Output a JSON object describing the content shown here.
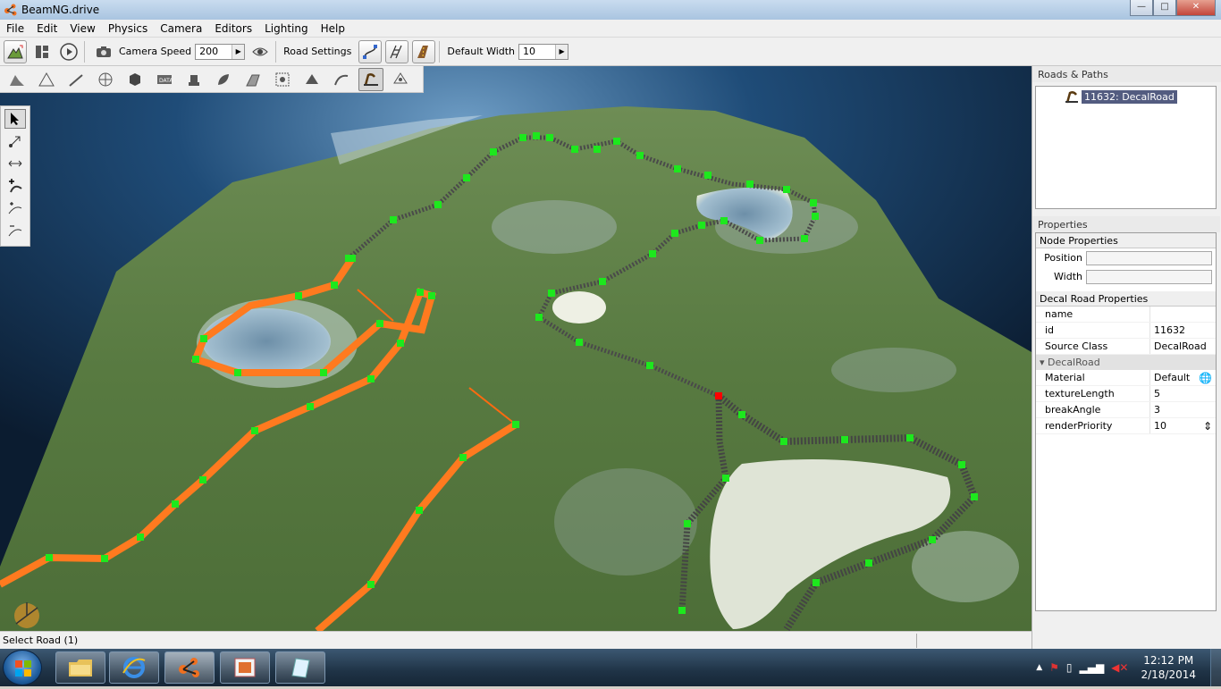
{
  "window": {
    "title": "BeamNG.drive",
    "minimize": "—",
    "maximize": "□",
    "close": "✕"
  },
  "menu": [
    "File",
    "Edit",
    "View",
    "Physics",
    "Camera",
    "Editors",
    "Lighting",
    "Help"
  ],
  "toolbar": {
    "camera_speed_label": "Camera Speed",
    "camera_speed_value": "200",
    "road_settings_label": "Road Settings",
    "default_width_label": "Default Width",
    "default_width_value": "10"
  },
  "editor_tools": [
    "terrain-editor-icon",
    "terrain-painter-icon",
    "mesh-road-icon",
    "river-icon",
    "object-icon",
    "datablock-icon",
    "forest-icon",
    "leaf-icon",
    "road-profile-icon",
    "decal-icon",
    "shape-icon",
    "sketch-icon",
    "decal-road-icon",
    "navmesh-icon"
  ],
  "road_tools": [
    "select-arrow-icon",
    "move-point-icon",
    "scale-point-icon",
    "add-road-icon",
    "insert-node-icon",
    "remove-node-icon"
  ],
  "roads_panel": {
    "title": "Roads & Paths",
    "item": "11632: DecalRoad"
  },
  "properties": {
    "title": "Properties",
    "node_section": "Node Properties",
    "position_label": "Position",
    "position_value": "",
    "width_label": "Width",
    "width_value": "",
    "decal_section": "Decal Road Properties",
    "rows": [
      {
        "k": "name",
        "v": ""
      },
      {
        "k": "id",
        "v": "11632"
      },
      {
        "k": "Source Class",
        "v": "DecalRoad"
      }
    ],
    "subsection": "DecalRoad",
    "sub_rows": [
      {
        "k": "Material",
        "v": "Default"
      },
      {
        "k": "textureLength",
        "v": "5"
      },
      {
        "k": "breakAngle",
        "v": "3"
      },
      {
        "k": "renderPriority",
        "v": "10"
      }
    ]
  },
  "status": {
    "text": "Select Road (1)"
  },
  "taskbar": {
    "time": "12:12 PM",
    "date": "2/18/2014"
  },
  "colors": {
    "selected_node": "#ff0000",
    "node": "#1de81d",
    "road_orange": "#ff7a1f",
    "water": "#7fa2bb",
    "terrain": "#5c7f46"
  }
}
